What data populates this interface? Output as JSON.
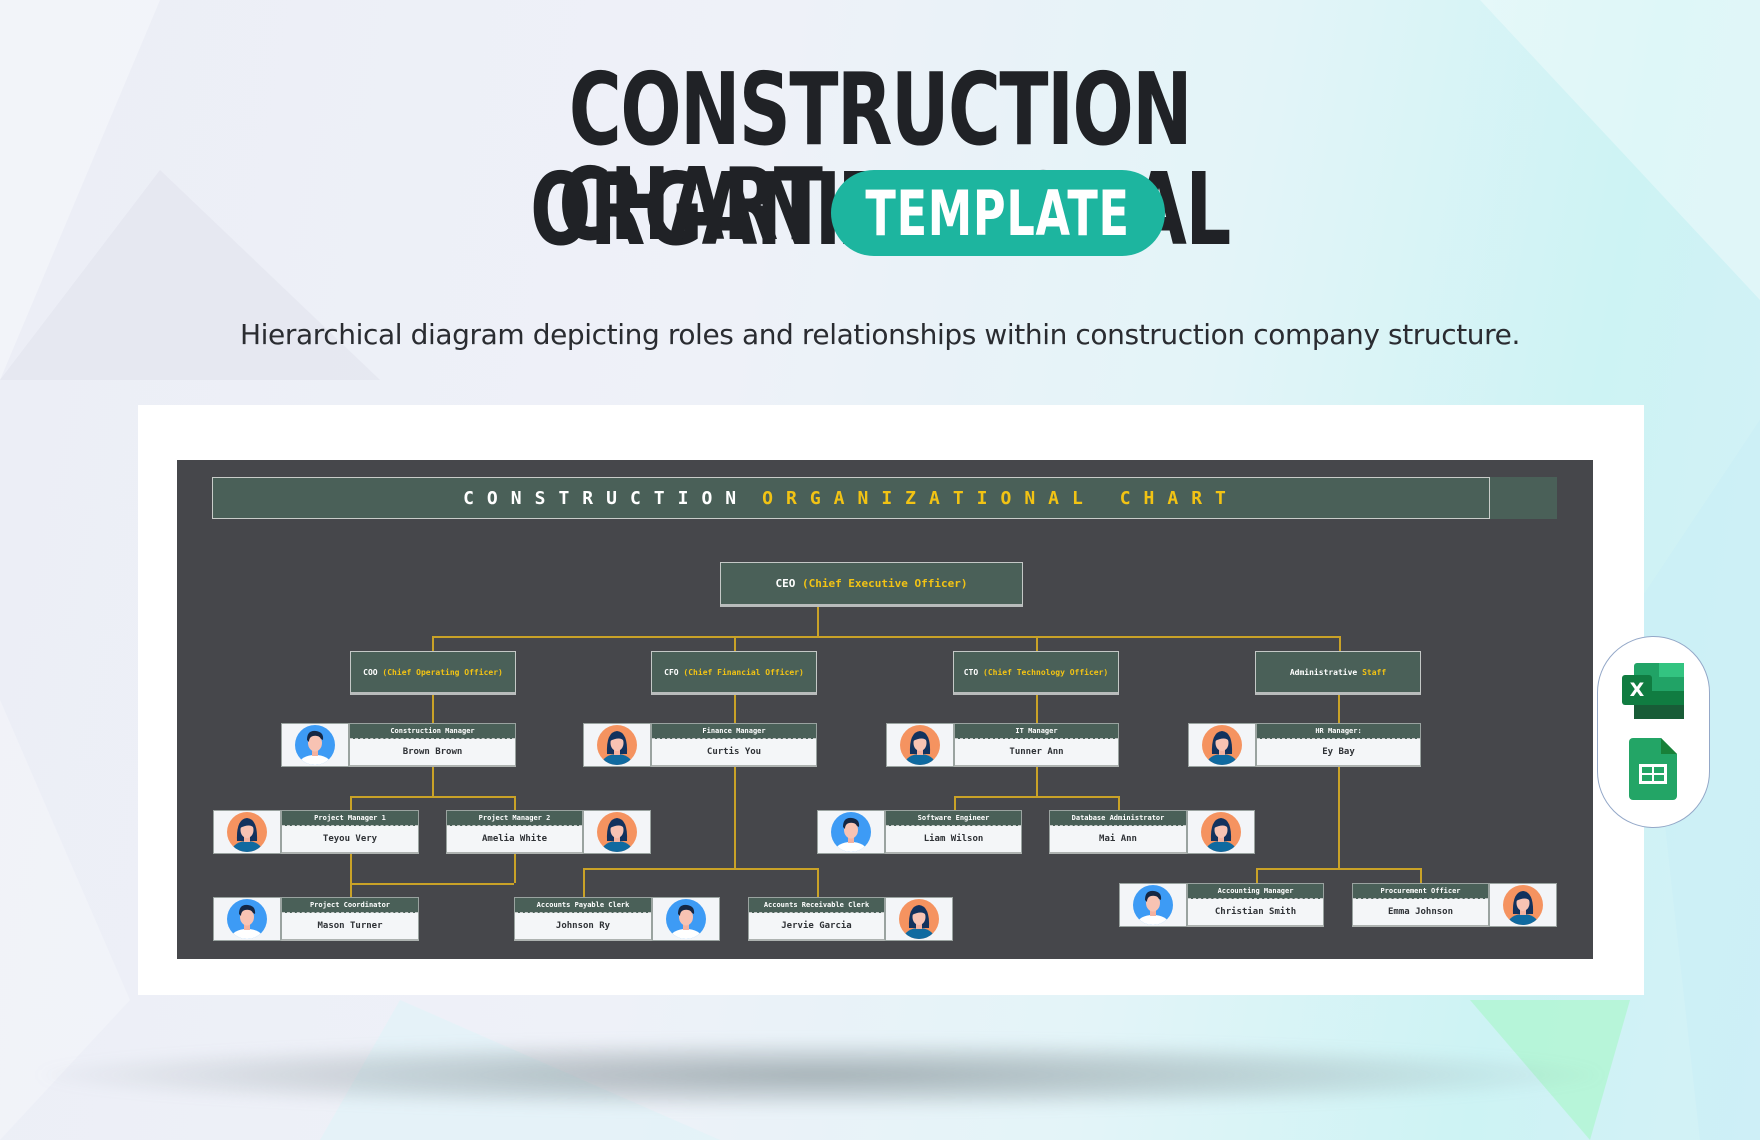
{
  "page": {
    "title_line1": "CONSTRUCTION ORGANIZATIONAL",
    "title_line2": "CHART",
    "badge": "TEMPLATE",
    "subtitle": "Hierarchical diagram depicting roles and relationships within construction company structure.",
    "colors": {
      "badge": "#1db59f",
      "panel": "#46474b",
      "box": "#4a6058",
      "accent": "#f2c314",
      "connector": "#c9a227"
    }
  },
  "chart": {
    "banner": {
      "part1": "CONSTRUCTION",
      "part2": "ORGANIZATIONAL CHART"
    },
    "ceo": {
      "abbr": "CEO",
      "full": "(Chief Executive Officer)"
    },
    "executives": [
      {
        "abbr": "COO",
        "full": "(Chief Operating Officer)"
      },
      {
        "abbr": "CFO",
        "full": "(Chief Financial Officer)"
      },
      {
        "abbr": "CTO",
        "full": "(Chief Technology Officer)"
      },
      {
        "abbr": "Administrative",
        "full": "Staff"
      }
    ],
    "people": [
      {
        "role": "Construction Manager",
        "name": "Brown Brown",
        "avatar": "male-avatar"
      },
      {
        "role": "Finance Manager",
        "name": "Curtis You",
        "avatar": "female-avatar"
      },
      {
        "role": "IT Manager",
        "name": "Tunner Ann",
        "avatar": "female-avatar"
      },
      {
        "role": "HR Manager:",
        "name": "Ey Bay",
        "avatar": "female-avatar"
      },
      {
        "role": "Project Manager 1",
        "name": "Teyou Very",
        "avatar": "female-avatar"
      },
      {
        "role": "Project Manager 2",
        "name": "Amelia White",
        "avatar": "female-avatar"
      },
      {
        "role": "Software Engineer",
        "name": "Liam Wilson",
        "avatar": "male-avatar"
      },
      {
        "role": "Database Administrator",
        "name": "Mai Ann",
        "avatar": "female-avatar"
      },
      {
        "role": "Project Coordinator",
        "name": "Mason Turner",
        "avatar": "male-avatar"
      },
      {
        "role": "Accounts Payable Clerk",
        "name": "Johnson Ry",
        "avatar": "male-avatar"
      },
      {
        "role": "Accounts Receivable Clerk",
        "name": "Jervie Garcia",
        "avatar": "female-avatar"
      },
      {
        "role": "Accounting Manager",
        "name": "Christian Smith",
        "avatar": "male-avatar"
      },
      {
        "role": "Procurement Officer",
        "name": "Emma Johnson",
        "avatar": "female-avatar"
      }
    ]
  },
  "apps": [
    {
      "name": "Microsoft Excel",
      "icon": "excel-icon",
      "letter": "X"
    },
    {
      "name": "Google Sheets",
      "icon": "google-sheets-icon"
    }
  ]
}
